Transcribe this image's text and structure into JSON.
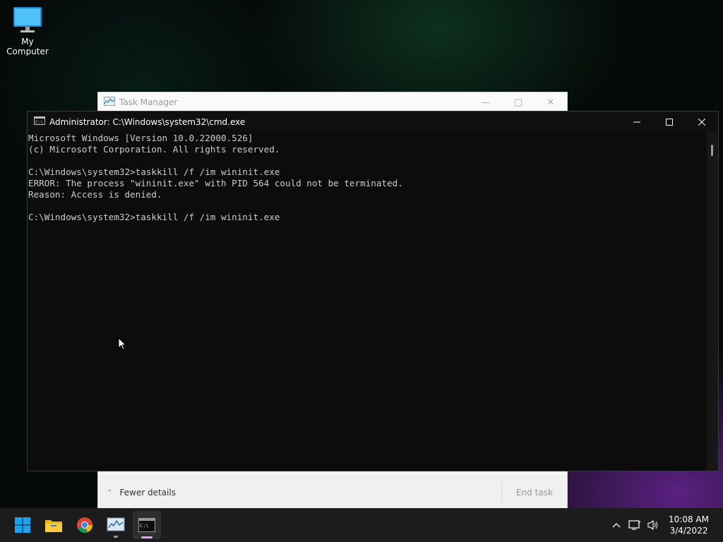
{
  "desktop": {
    "my_computer_label": "My Computer"
  },
  "task_manager": {
    "title": "Task Manager",
    "fewer_details": "Fewer details",
    "end_task": "End task"
  },
  "cmd": {
    "title": "Administrator: C:\\Windows\\system32\\cmd.exe",
    "lines": [
      "Microsoft Windows [Version 10.0.22000.526]",
      "(c) Microsoft Corporation. All rights reserved.",
      "",
      "C:\\Windows\\system32>taskkill /f /im wininit.exe",
      "ERROR: The process \"wininit.exe\" with PID 564 could not be terminated.",
      "Reason: Access is denied.",
      "",
      "C:\\Windows\\system32>taskkill /f /im wininit.exe"
    ]
  },
  "taskbar": {
    "apps": [
      "start-icon",
      "file-explorer-icon",
      "chrome-icon",
      "task-manager-icon",
      "cmd-icon"
    ],
    "time": "10:08 AM",
    "date": "3/4/2022"
  },
  "colors": {
    "accent": "#0078d4",
    "terminal_text": "#cccccc",
    "active_indicator": "#d9a6e6"
  }
}
